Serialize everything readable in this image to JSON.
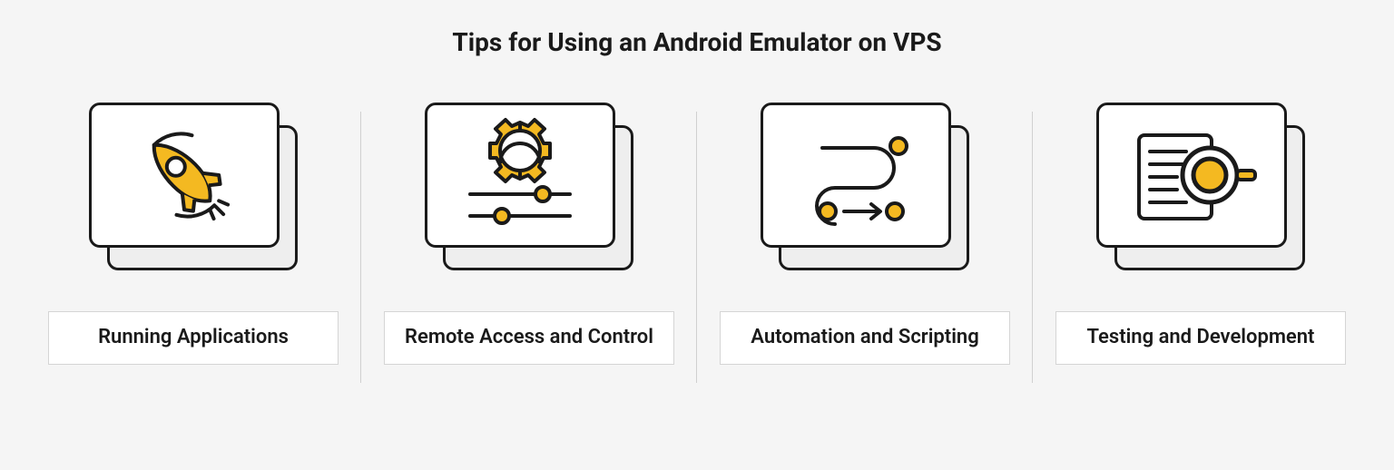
{
  "title": "Tips for Using an Android Emulator on VPS",
  "cards": [
    {
      "label": "Running Applications",
      "icon": "rocket-icon"
    },
    {
      "label": "Remote Access and Control",
      "icon": "sliders-gear-icon"
    },
    {
      "label": "Automation and Scripting",
      "icon": "flow-path-icon"
    },
    {
      "label": "Testing and Development",
      "icon": "magnifier-document-icon"
    }
  ],
  "colors": {
    "accent": "#f4b921",
    "stroke": "#1a1a1a",
    "panel_back": "#eeeeee",
    "background": "#f5f5f5",
    "label_border": "#d5d5d5"
  }
}
